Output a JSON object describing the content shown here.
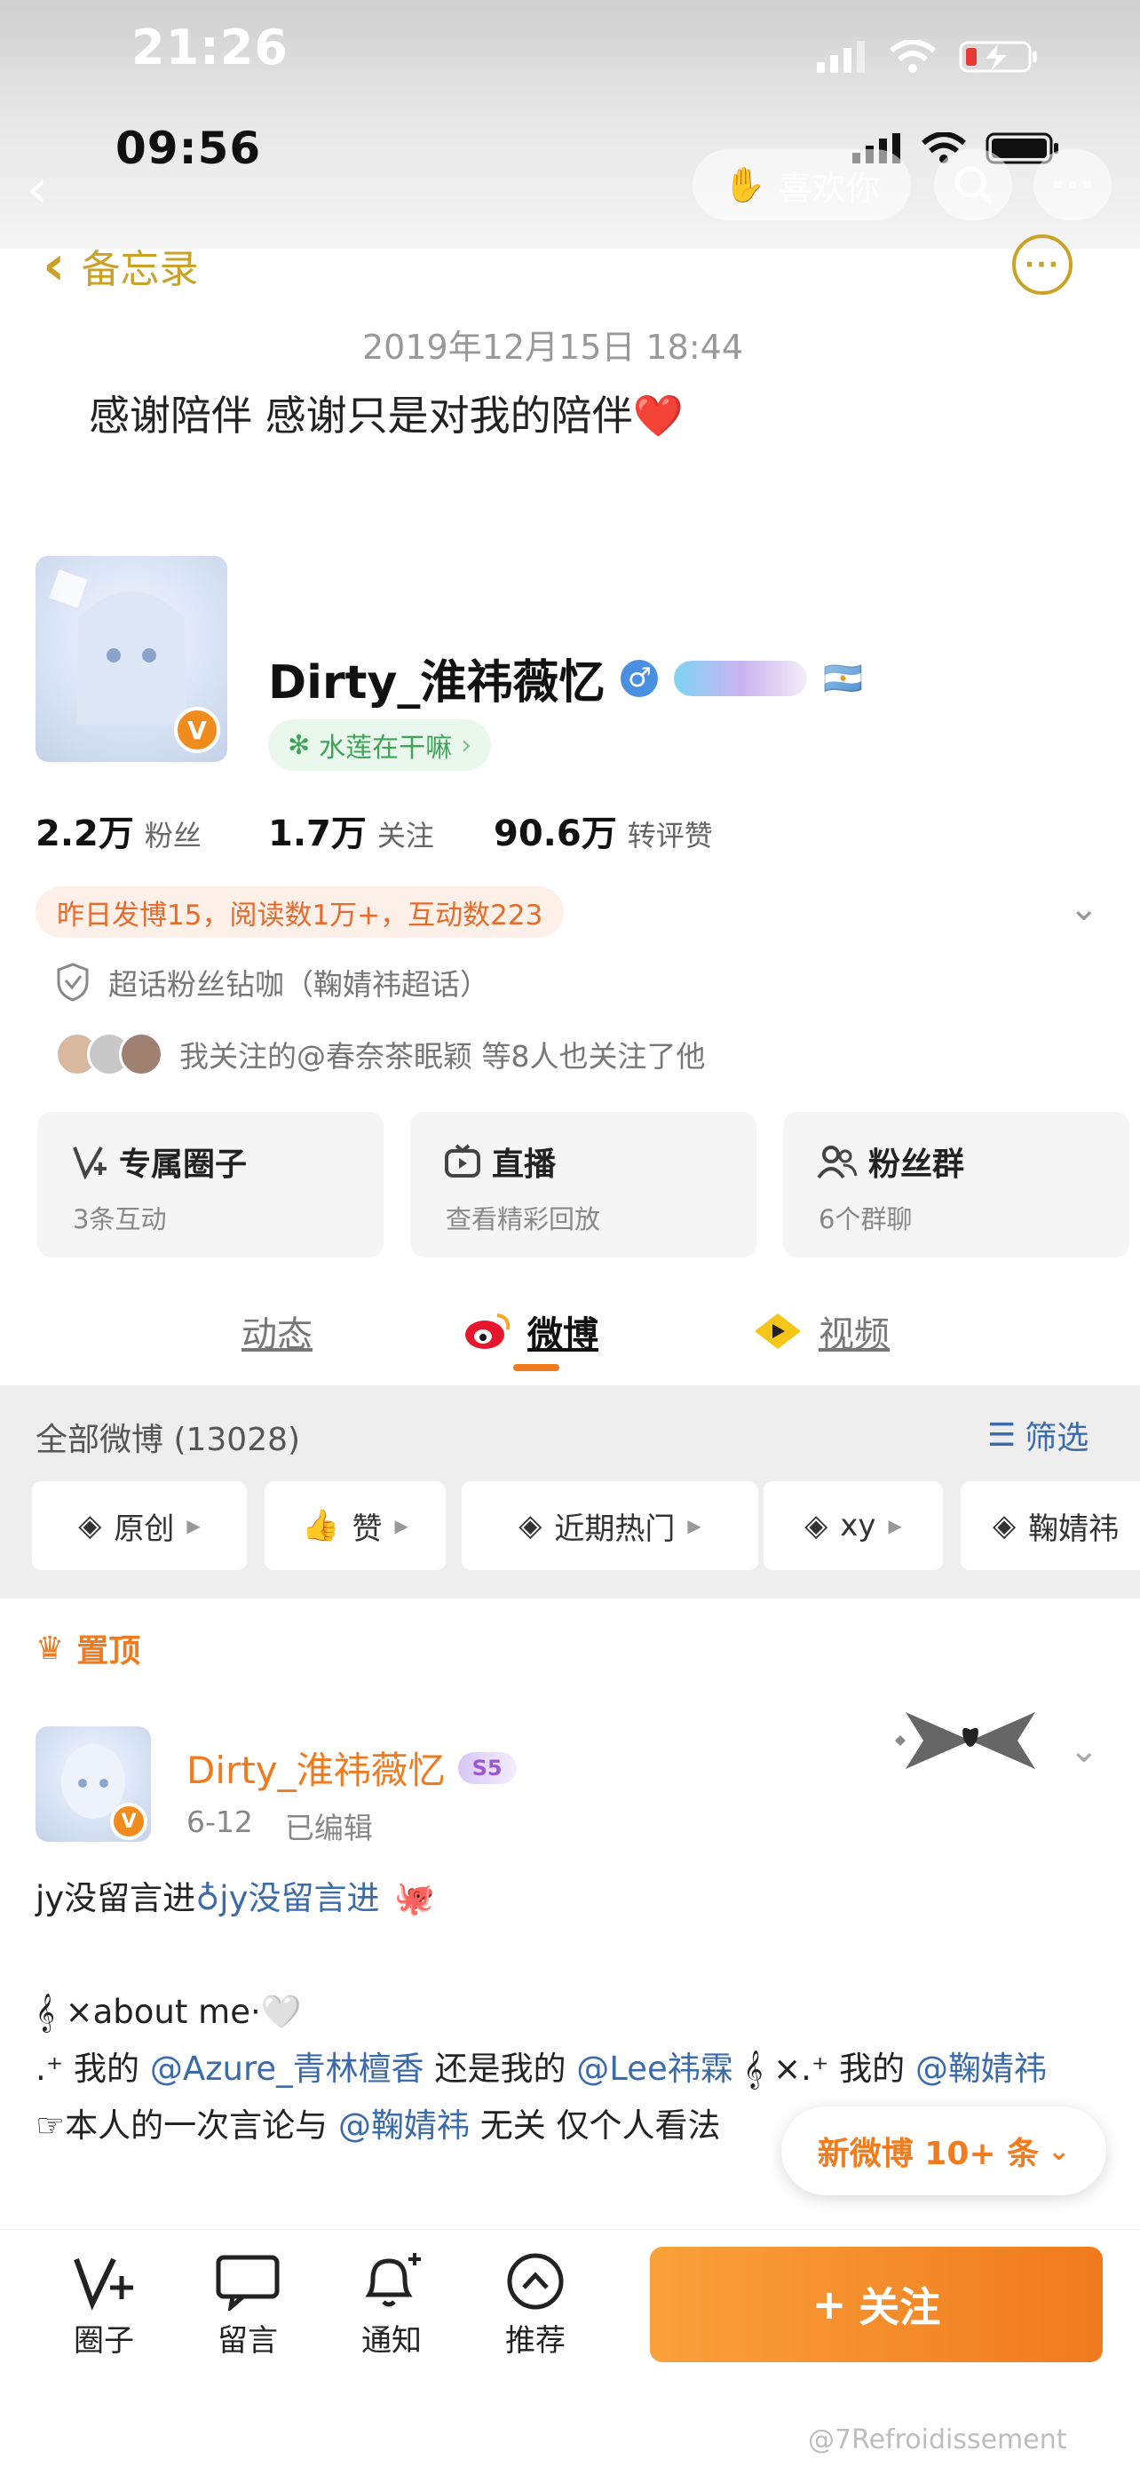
{
  "status_bar_outer": {
    "time": "21:26"
  },
  "status_bar_inner": {
    "time": "09:56"
  },
  "top_actions": {
    "like_label": "喜欢你"
  },
  "memo": {
    "back_label": "备忘录",
    "date": "2019年12月15日 18:44",
    "text": "感谢陪伴 感谢只是对我的陪伴❤️"
  },
  "profile": {
    "name": "Dirty_淮祎薇忆",
    "gender_symbol": "♂",
    "flag": "🇦🇷",
    "topic_tag": "水莲在干嘛",
    "stats": [
      {
        "num": "2.2万",
        "label": "粉丝"
      },
      {
        "num": "1.7万",
        "label": "关注"
      },
      {
        "num": "90.6万",
        "label": "转评赞"
      }
    ],
    "notice": "昨日发博15，阅读数1万+，互动数223",
    "super_topic": "超话粉丝钻咖（鞠婧祎超话）",
    "mutual": "我关注的@春奈茶眠颖 等8人也关注了他"
  },
  "cards": [
    {
      "title": "专属圈子",
      "sub": "3条互动",
      "icon": "circle-v-icon"
    },
    {
      "title": "直播",
      "sub": "查看精彩回放",
      "icon": "live-tv-icon"
    },
    {
      "title": "粉丝群",
      "sub": "6个群聊",
      "icon": "group-icon"
    }
  ],
  "tabs": [
    "动态",
    "微博",
    "视频"
  ],
  "feed": {
    "all_label": "全部微博 (13028)",
    "filter_label": "筛选",
    "chips": [
      "原创",
      "赞",
      "近期热门",
      "xy",
      "鞠婧祎"
    ]
  },
  "pinned_label": "置顶",
  "post": {
    "author": "Dirty_淮祎薇忆",
    "level": "S5",
    "date": "6-12",
    "edited": "已编辑",
    "line1_text": "jy没留言进 ",
    "line1_link": "jy没留言进",
    "line2": "𝄞 ×about me·🤍",
    "line3_pre": ".⁺ 我的",
    "line3_link1": "@Azure_青林檀香",
    "line3_mid": " 还是我的",
    "line3_link2": "@Lee祎霖",
    "line3_mid2": " 𝄞 ×.⁺ 我的",
    "line3_link3": "@鞠婧祎",
    "line4_pre": "☞本人的一次言论与",
    "line4_link": "@鞠婧祎",
    "line4_post": " 无关 仅个人看法"
  },
  "new_posts": "新微博 10+ 条",
  "bottom_nav": [
    {
      "label": "圈子",
      "icon": "circle-v-icon"
    },
    {
      "label": "留言",
      "icon": "message-icon"
    },
    {
      "label": "通知",
      "icon": "bell-plus-icon"
    },
    {
      "label": "推荐",
      "icon": "chevron-up-circle-icon"
    }
  ],
  "follow_label": "关注",
  "watermark": "@7Refroidissement",
  "colors": {
    "accent": "#f07a1e",
    "memo_gold": "#c9a227",
    "link": "#3b6ba8"
  }
}
